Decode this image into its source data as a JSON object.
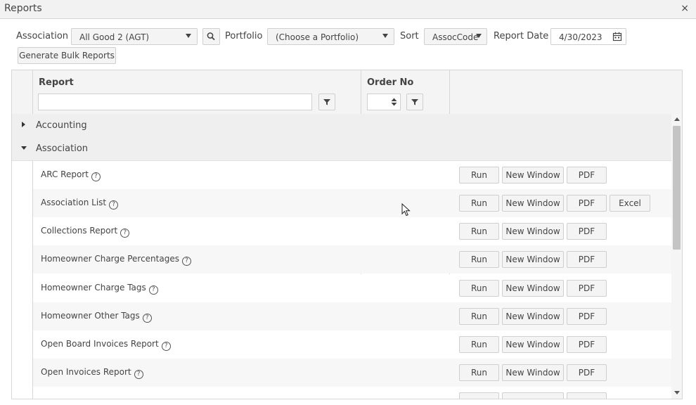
{
  "window": {
    "title": "Reports",
    "close_glyph": "×"
  },
  "toolbar": {
    "association_label": "Association",
    "association_value": "All Good 2 (AGT)",
    "portfolio_label": "Portfolio",
    "portfolio_value": "(Choose a Portfolio)",
    "sort_label": "Sort",
    "sort_value": "AssocCode",
    "report_date_label": "Report Date",
    "report_date_value": "4/30/2023",
    "generate_bulk_label": "Generate Bulk Reports"
  },
  "grid": {
    "columns": {
      "report": "Report",
      "order_no": "Order No"
    },
    "groups": [
      {
        "label": "Accounting",
        "expanded": false
      },
      {
        "label": "Association",
        "expanded": true
      }
    ],
    "buttons": {
      "run": "Run",
      "new_window": "New Window",
      "pdf": "PDF",
      "excel": "Excel"
    },
    "rows": [
      {
        "name": "ARC Report",
        "excel": false
      },
      {
        "name": "Association List",
        "excel": true
      },
      {
        "name": "Collections Report",
        "excel": false
      },
      {
        "name": "Homeowner Charge Percentages",
        "excel": false
      },
      {
        "name": "Homeowner Charge Tags",
        "excel": false
      },
      {
        "name": "Homeowner Other Tags",
        "excel": false
      },
      {
        "name": "Open Board Invoices Report",
        "excel": false
      },
      {
        "name": "Open Invoices Report",
        "excel": false
      }
    ]
  },
  "icons": [
    "close-icon",
    "search-icon",
    "calendar-icon",
    "filter-icon",
    "chevron-down-icon",
    "help-icon",
    "spinner-arrows-icon",
    "cursor-icon"
  ],
  "colors": {
    "header_bg": "#f4f4f4",
    "group_bg": "#efefef",
    "alt_row_bg": "#f7f7f7",
    "border": "#d6d6d6"
  }
}
